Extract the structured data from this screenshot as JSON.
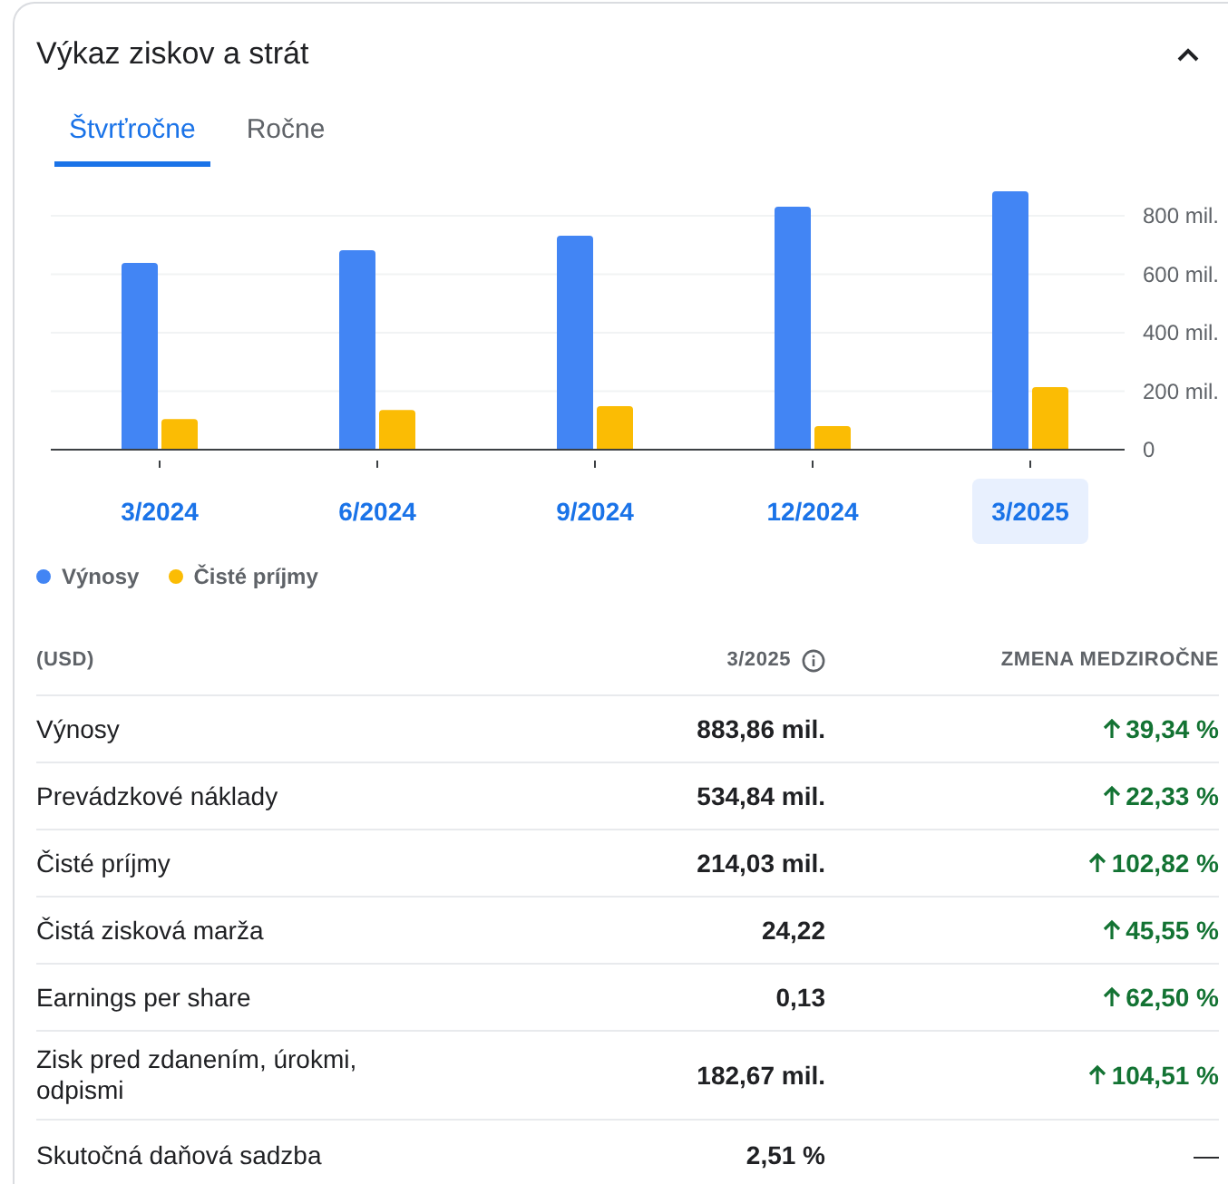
{
  "title": "Výkaz ziskov a strát",
  "collapse": {
    "expanded": true
  },
  "tabs": [
    {
      "label": "Štvrťročne",
      "selected": true
    },
    {
      "label": "Ročne",
      "selected": false
    }
  ],
  "chart_data": {
    "type": "bar",
    "categories": [
      "3/2024",
      "6/2024",
      "9/2024",
      "12/2024",
      "3/2025"
    ],
    "series": [
      {
        "name": "Výnosy",
        "color": "#4285f4",
        "values": [
          639,
          682,
          732,
          831,
          884
        ]
      },
      {
        "name": "Čisté príjmy",
        "color": "#fbbc04",
        "values": [
          105,
          136,
          149,
          81,
          214
        ]
      }
    ],
    "grid": true,
    "ylim": [
      0,
      900
    ],
    "yticks": [
      {
        "value": 0,
        "label": "0"
      },
      {
        "value": 200,
        "label": "200 mil."
      },
      {
        "value": 400,
        "label": "400 mil."
      },
      {
        "value": 600,
        "label": "600 mil."
      },
      {
        "value": 800,
        "label": "800 mil."
      }
    ]
  },
  "periods": [
    {
      "selected": false
    },
    {
      "selected": false
    },
    {
      "selected": false
    },
    {
      "selected": false
    },
    {
      "selected": true
    }
  ],
  "table": {
    "columns": [
      "(USD)",
      "3/2025",
      "ZMENA MEDZIROČNE"
    ],
    "rows": [
      {
        "label": "Výnosy",
        "value": "883,86 mil.",
        "change": "39,34 %",
        "kind": "up"
      },
      {
        "label": "Prevádzkové náklady",
        "value": "534,84 mil.",
        "change": "22,33 %",
        "kind": "up"
      },
      {
        "label": "Čisté príjmy",
        "value": "214,03 mil.",
        "change": "102,82 %",
        "kind": "up"
      },
      {
        "label": "Čistá zisková marža",
        "value": "24,22",
        "change": "45,55 %",
        "kind": "up"
      },
      {
        "label": "Earnings per share",
        "value": "0,13",
        "change": "62,50 %",
        "kind": "up"
      },
      {
        "label": "Zisk pred zdanením, úrokmi, odpismi",
        "value": "182,67 mil.",
        "change": "104,51 %",
        "kind": "up"
      },
      {
        "label": "Skutočná daňová sadzba",
        "value": "2,51 %",
        "change": "—",
        "kind": "none"
      }
    ]
  }
}
